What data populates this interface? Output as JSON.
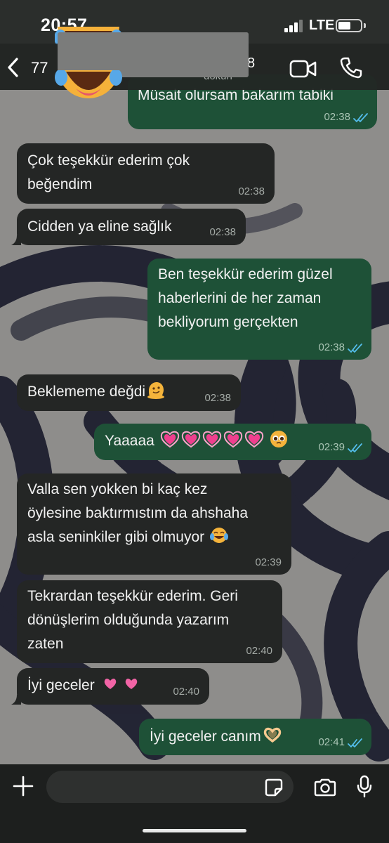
{
  "status_bar": {
    "time": "20:57",
    "network": "LTE",
    "signal_bars": 3,
    "battery_level": 0.55
  },
  "header": {
    "back_label": "<",
    "unread_count": "77",
    "contact_name_visible": "8",
    "subtitle_visible": "dokun",
    "video_icon": "video-camera-icon",
    "call_icon": "phone-icon",
    "avatar": "laughing-face-emoji"
  },
  "messages": [
    {
      "side": "out",
      "text": "Müsait olursam bakarım tabiki",
      "time": "02:38",
      "status": "read"
    },
    {
      "side": "in",
      "lines": [
        "Çok teşekkür ederim çok",
        "beğendim"
      ],
      "time": "02:38"
    },
    {
      "side": "in",
      "lines": [
        "Cidden ya eline sağlık"
      ],
      "time": "02:38"
    },
    {
      "side": "out",
      "lines": [
        "Ben teşekkür ederim güzel",
        "haberlerini de her zaman",
        "bekliyorum gerçekten"
      ],
      "time": "02:38",
      "status": "read"
    },
    {
      "side": "in",
      "lines": [
        "Beklememe değdi"
      ],
      "emoji": "melting-face",
      "time": "02:38"
    },
    {
      "side": "out",
      "lines": [
        "Yaaaaa"
      ],
      "emoji": "growing-hearts-x5-pleading-face",
      "time": "02:39",
      "status": "read"
    },
    {
      "side": "in",
      "lines": [
        "Valla sen yokken bi kaç kez",
        "öylesine baktırmıstım da ahshaha",
        "asla seninkiler gibi olmuyor"
      ],
      "emoji": "tears-of-joy",
      "time": "02:39"
    },
    {
      "side": "in",
      "lines": [
        "Tekrardan teşekkür ederim. Geri",
        "dönüşlerim olduğunda yazarım",
        "zaten"
      ],
      "time": "02:40"
    },
    {
      "side": "in",
      "lines": [
        "İyi geceler"
      ],
      "emoji": "two-pink-hearts",
      "time": "02:40"
    },
    {
      "side": "out",
      "lines": [
        "İyi geceler canım"
      ],
      "emoji": "heart-hands",
      "time": "02:41",
      "status": "read"
    }
  ],
  "input": {
    "placeholder": "",
    "icons": [
      "plus-icon",
      "sticker-icon",
      "camera-icon",
      "microphone-icon"
    ]
  },
  "colors": {
    "incoming_bubble": "#242625",
    "outgoing_bubble": "#1e5137",
    "read_ticks": "#53bdeb",
    "bar_background": "#232624"
  }
}
